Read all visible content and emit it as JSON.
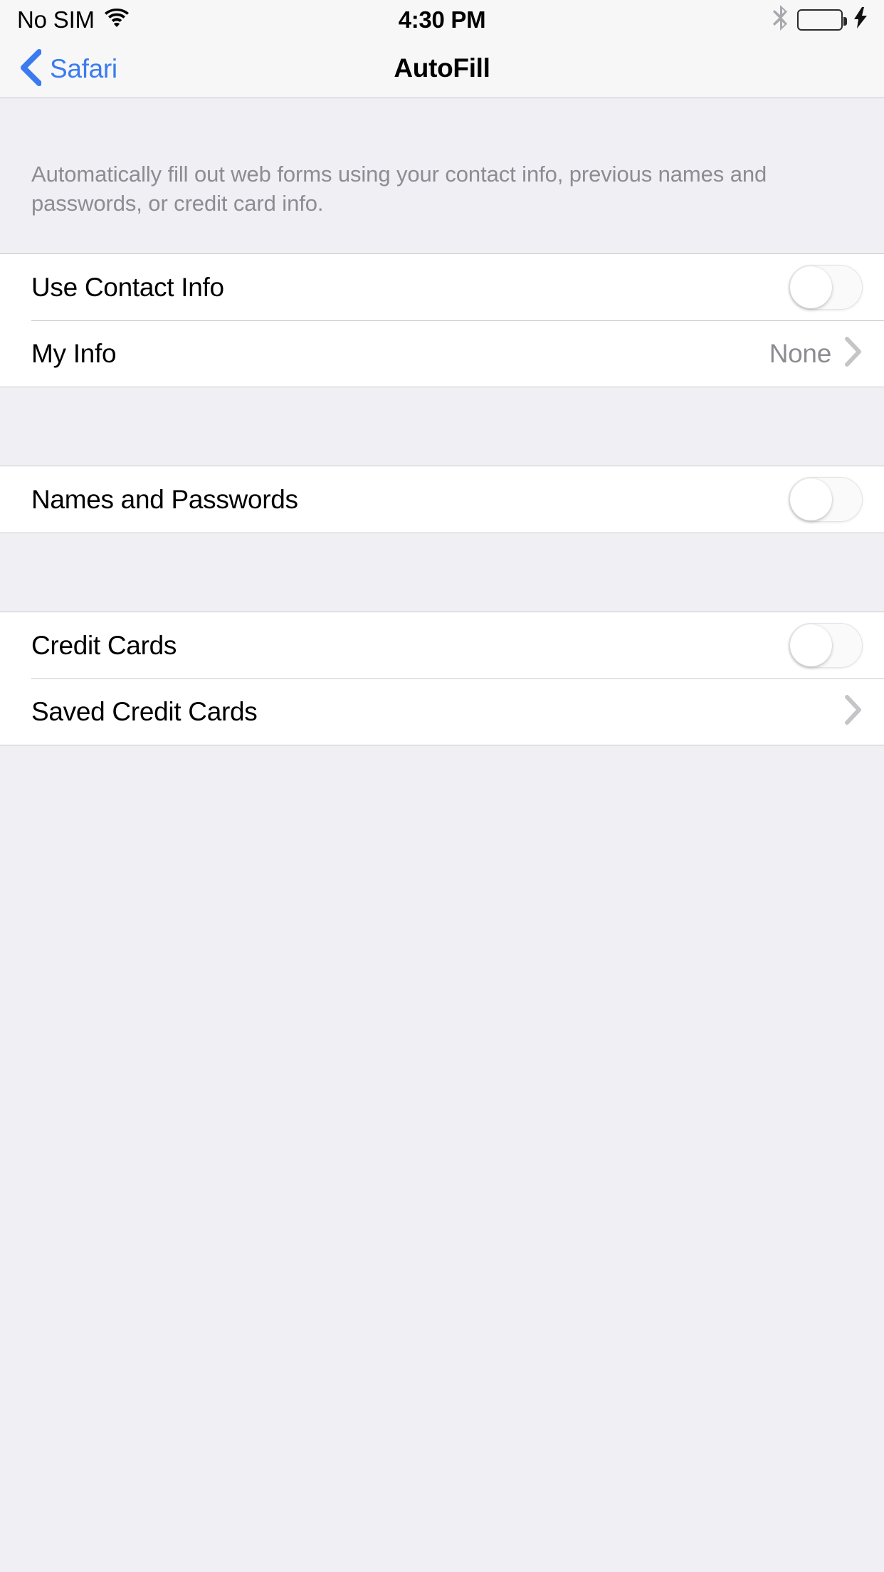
{
  "status_bar": {
    "carrier": "No SIM",
    "wifi_icon": "wifi-icon",
    "time": "4:30 PM",
    "bluetooth_icon": "bluetooth-icon",
    "battery_icon": "battery-icon",
    "battery_level_percent": 100,
    "battery_color": "#6ED660",
    "charging_icon": "lightning-bolt-icon"
  },
  "nav_bar": {
    "back_icon": "chevron-left-icon",
    "back_label": "Safari",
    "title": "AutoFill",
    "tint_color": "#3A7BEF"
  },
  "section_note": "Automatically fill out web forms using your contact info, previous names and passwords, or credit card info.",
  "groups": [
    {
      "rows": [
        {
          "label": "Use Contact Info",
          "control": "toggle",
          "toggle_state": "off",
          "name": "use-contact-info"
        },
        {
          "label": "My Info",
          "control": "disclosure",
          "value": "None",
          "name": "my-info"
        }
      ]
    },
    {
      "rows": [
        {
          "label": "Names and Passwords",
          "control": "toggle",
          "toggle_state": "off",
          "name": "names-and-passwords"
        }
      ]
    },
    {
      "rows": [
        {
          "label": "Credit Cards",
          "control": "toggle",
          "toggle_state": "off",
          "name": "credit-cards"
        },
        {
          "label": "Saved Credit Cards",
          "control": "disclosure",
          "value": "",
          "name": "saved-credit-cards"
        }
      ]
    }
  ]
}
